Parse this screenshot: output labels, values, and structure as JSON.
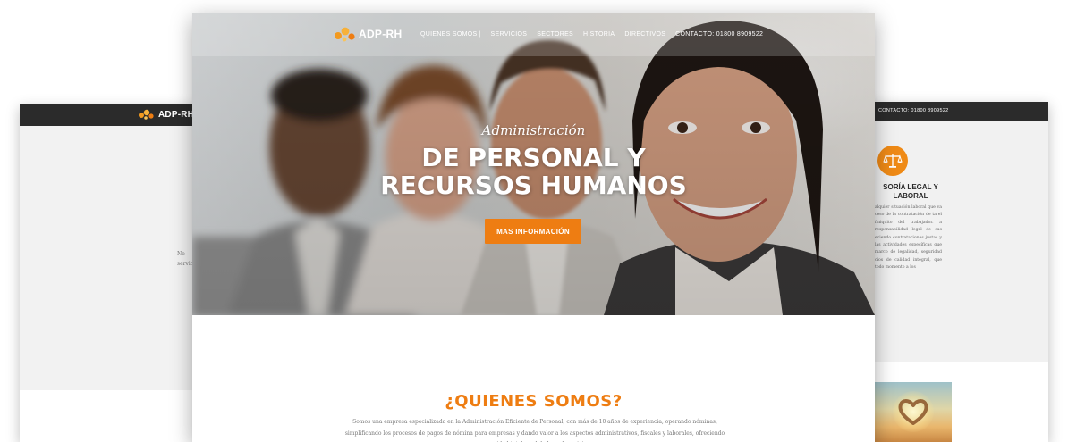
{
  "left_mockup": {
    "logo_text": "ADP-RH",
    "fragment_lines": [
      "Ne",
      "servic"
    ]
  },
  "right_mockup": {
    "contact_text": "CONTACTO: 01800 8909522",
    "service_title": "SORÍA LEGAL Y LABORAL",
    "service_text": "alquier situación laboral que va ceso de la contratación de ta el finiquito del trabajador. a responsabilidad legal de sus eciendo contrataciones justas y las actividades específicas que marco de legalidad, seguridad cios de calidad integral, que todo momento a los",
    "service_icon": "balance-scale-icon"
  },
  "main": {
    "logo_text": "ADP-RH",
    "nav": {
      "quienes": "QUIENES SOMOS",
      "servicios": "SERVICIOS",
      "sectores": "SECTORES",
      "historia": "HISTORIA",
      "directivos": "DIRECTIVOS",
      "contacto": "CONTACTO: 01800 8909522"
    },
    "hero": {
      "subtitle": "Administración",
      "title_line1": "DE PERSONAL Y",
      "title_line2": "RECURSOS HUMANOS",
      "button": "MAS INFORMACIÓN"
    },
    "about": {
      "title": "¿QUIENES SOMOS?",
      "text": "Somos una empresa especializada en la Administración Eficiente de Personal, con más de 10 años de experiencia, operando nóminas, simplificando los procesos de pagos de nómina para empresas y dando valor a los aspectos administrativos, fiscales y laborales, ofreciendo seguridad total y calidad en el servicio."
    }
  },
  "colors": {
    "accent": "#ee7d12",
    "dark_bar": "#2b2b2b",
    "panel": "#f1f1f1"
  }
}
